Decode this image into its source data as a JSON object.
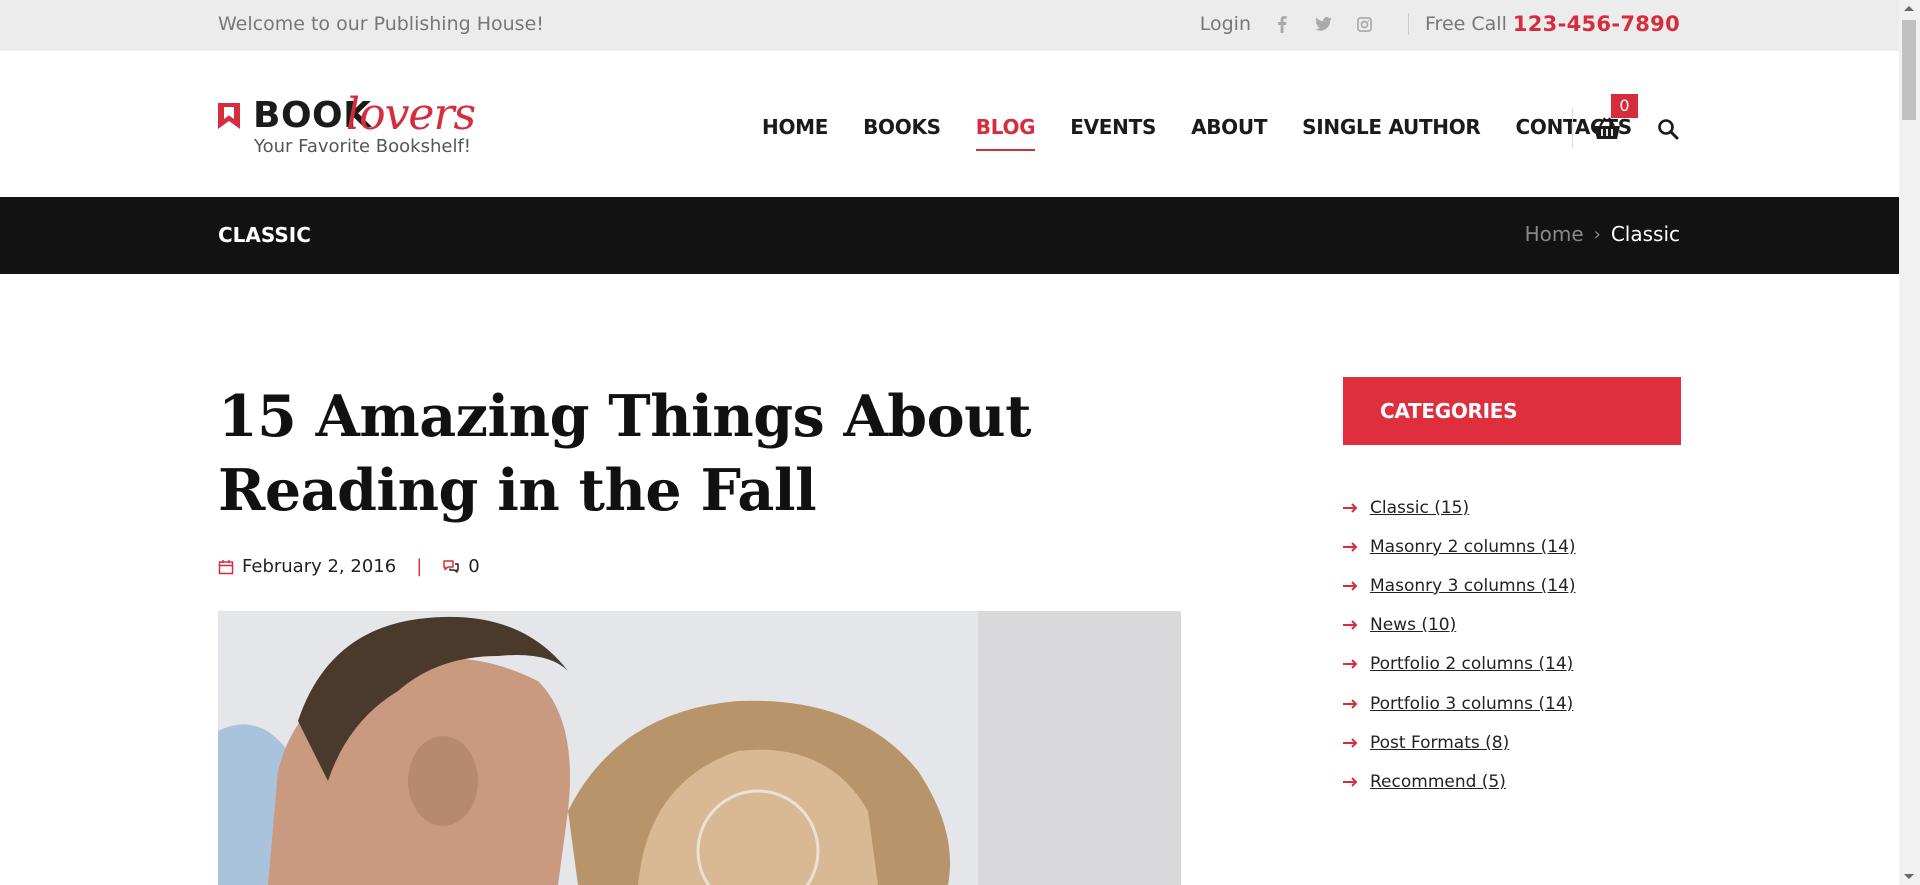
{
  "topbar": {
    "welcome": "Welcome to our Publishing House!",
    "login": "Login",
    "social": [
      "facebook-icon",
      "twitter-icon",
      "instagram-icon"
    ],
    "free_call": "Free Call",
    "phone": "123-456-7890"
  },
  "logo": {
    "book": "BOOK",
    "lovers": "lovers",
    "tagline": "Your Favorite Bookshelf!"
  },
  "nav": {
    "items": [
      "HOME",
      "BOOKS",
      "BLOG",
      "EVENTS",
      "ABOUT",
      "SINGLE AUTHOR",
      "CONTACTS"
    ],
    "active": "BLOG"
  },
  "cart": {
    "count": "0"
  },
  "page_title": "CLASSIC",
  "breadcrumb": {
    "home": "Home",
    "current": "Classic"
  },
  "post": {
    "title": "15 Amazing Things About Reading in the Fall",
    "date": "February 2, 2016",
    "comments": "0"
  },
  "sidebar": {
    "categories_title": "CATEGORIES",
    "categories": [
      "Classic (15)",
      "Masonry 2 columns (14)",
      "Masonry 3 columns (14)",
      "News (10)",
      "Portfolio 2 columns (14)",
      "Portfolio 3 columns (14)",
      "Post Formats (8)",
      "Recommend (5)"
    ]
  },
  "colors": {
    "accent": "#d62d3d",
    "dark": "#121212",
    "topbar": "#ececec"
  }
}
